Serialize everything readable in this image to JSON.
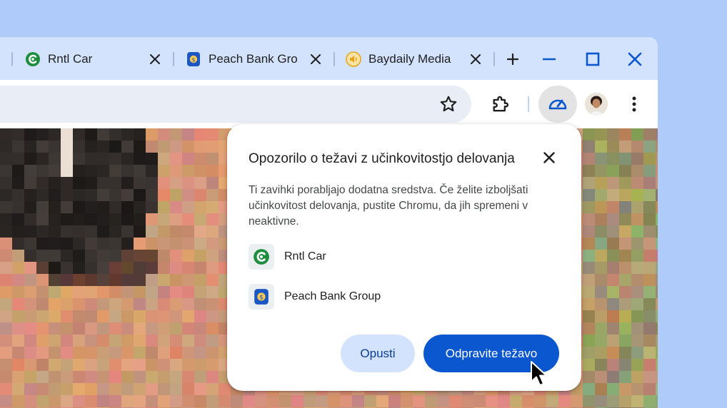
{
  "tabs": [
    {
      "title": "Rntl Car",
      "icon": "rntl-car-favicon",
      "color": "#1e8e3e"
    },
    {
      "title": "Peach Bank Gro",
      "icon": "peach-bank-favicon",
      "color": "#1a56c4"
    },
    {
      "title": "Baydaily Media",
      "icon": "baydaily-media-favicon",
      "color": "#e8a317"
    }
  ],
  "dialog": {
    "title": "Opozorilo o težavi z učinkovitostjo delovanja",
    "body": "Ti zavihki porabljajo dodatna sredstva. Če želite izboljšati učinkovitost delovanja, pustite Chromu, da jih spremeni v neaktivne.",
    "items": [
      {
        "label": "Rntl Car",
        "icon": "rntl-car-favicon"
      },
      {
        "label": "Peach Bank Group",
        "icon": "peach-bank-favicon"
      }
    ],
    "dismiss_label": "Opusti",
    "fix_label": "Odpravite težavo"
  },
  "colors": {
    "background": "#aecbfa",
    "frame": "#d3e3fd",
    "accent": "#0b57d0",
    "dismiss_bg": "#d3e3fd"
  }
}
